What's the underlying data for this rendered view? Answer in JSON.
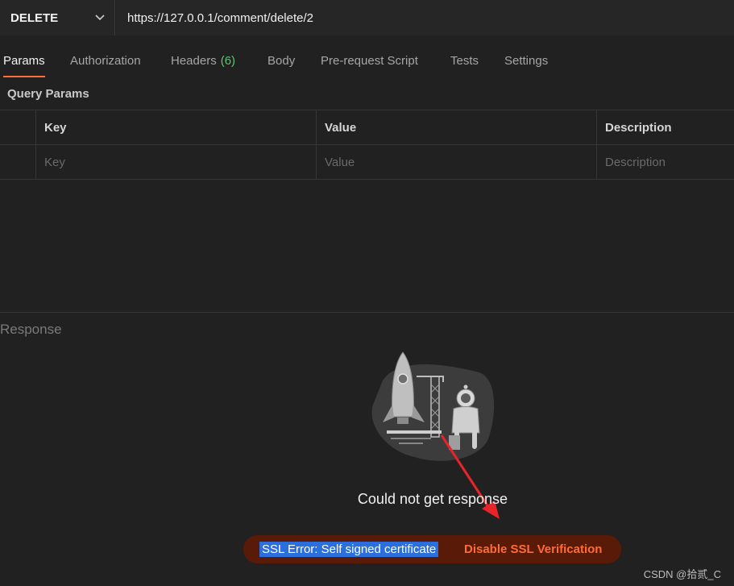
{
  "request": {
    "method": "DELETE",
    "url": "https://127.0.0.1/comment/delete/2"
  },
  "tabs": [
    {
      "label": "Params",
      "active": true
    },
    {
      "label": "Authorization"
    },
    {
      "label": "Headers",
      "count": "(6)"
    },
    {
      "label": "Body"
    },
    {
      "label": "Pre-request Script"
    },
    {
      "label": "Tests"
    },
    {
      "label": "Settings"
    }
  ],
  "params": {
    "title": "Query Params",
    "headers": [
      "Key",
      "Value",
      "Description"
    ],
    "placeholders": [
      "Key",
      "Value",
      "Description"
    ]
  },
  "response": {
    "title": "Response",
    "message": "Could not get response",
    "ssl_error": "SSL Error: Self signed certificate",
    "ssl_action": "Disable SSL Verification"
  },
  "watermark": "CSDN @拾贰_C",
  "colors": {
    "accent": "#ff6c37",
    "count": "#5ac56a",
    "background": "#212121",
    "annotation_arrow": "#e8242b"
  }
}
